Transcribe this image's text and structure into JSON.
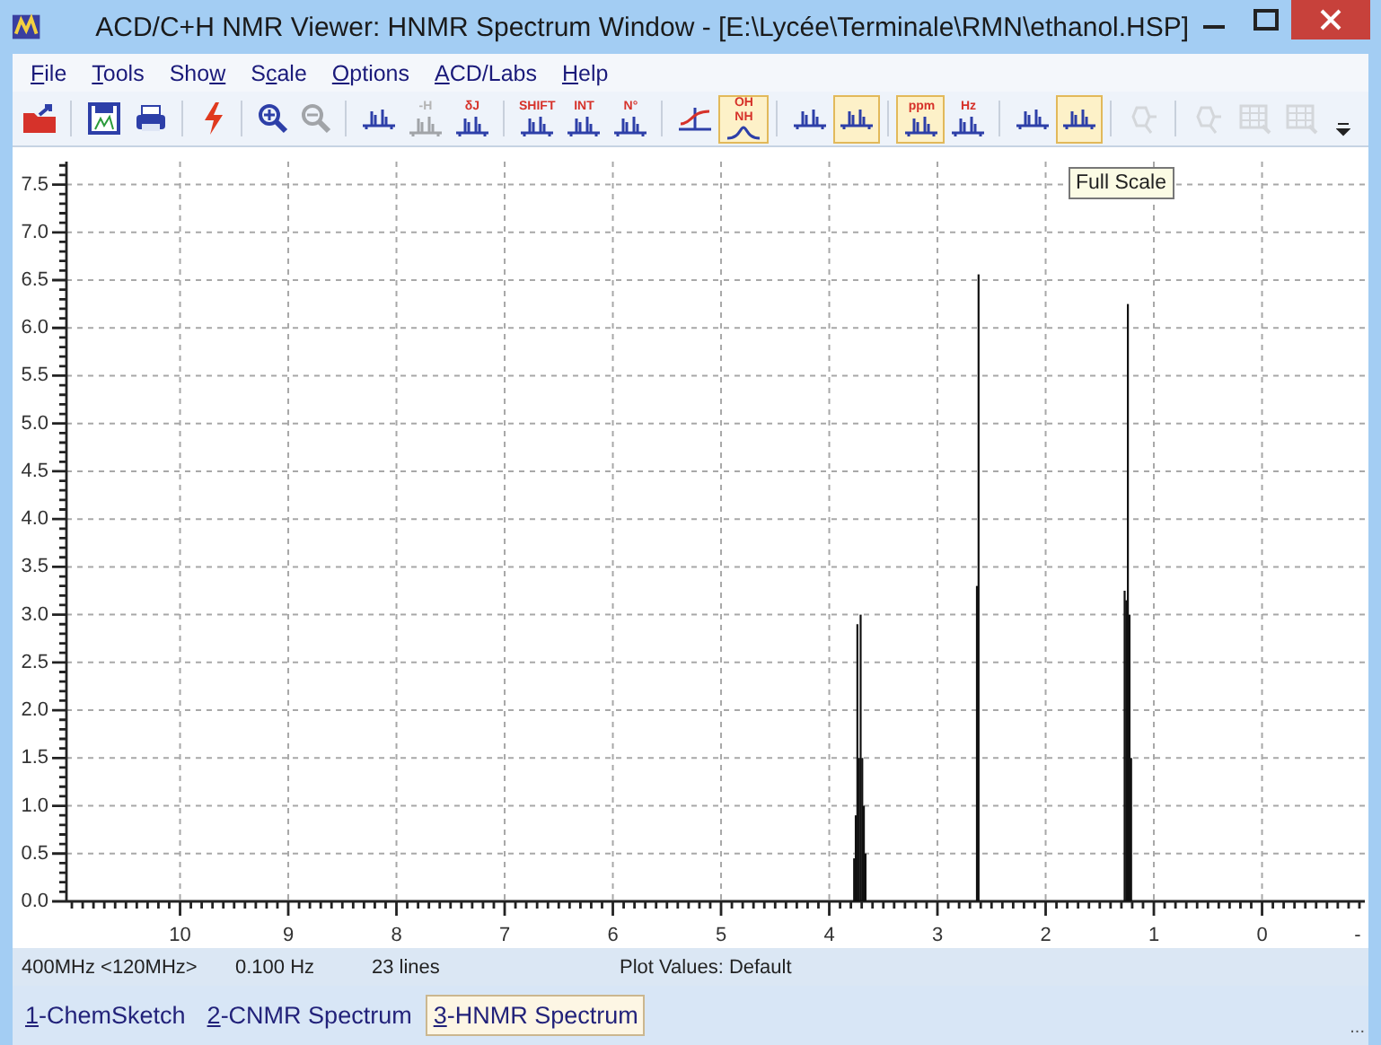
{
  "window": {
    "title": "ACD/C+H NMR Viewer: HNMR Spectrum Window - [E:\\Lycée\\Terminale\\RMN\\ethanol.HSP]"
  },
  "menu": [
    {
      "key": "F",
      "post": "ile"
    },
    {
      "key": "T",
      "post": "ools"
    },
    {
      "pre": "Sho",
      "key": "w"
    },
    {
      "pre": "S",
      "key": "c",
      "post": "ale"
    },
    {
      "key": "O",
      "post": "ptions"
    },
    {
      "key": "A",
      "post": "CD/Labs"
    },
    {
      "key": "H",
      "post": "elp"
    }
  ],
  "toolbar": [
    {
      "kind": "open",
      "separator_before": false,
      "selected": false,
      "disabled": false
    },
    {
      "kind": "save",
      "separator_before": true,
      "selected": false,
      "disabled": false
    },
    {
      "kind": "print",
      "separator_before": false,
      "selected": false,
      "disabled": false
    },
    {
      "kind": "lightning",
      "separator_before": true,
      "selected": false,
      "disabled": false
    },
    {
      "kind": "zoom-in",
      "separator_before": true,
      "selected": false,
      "disabled": false
    },
    {
      "kind": "zoom-out",
      "separator_before": false,
      "selected": false,
      "disabled": true
    },
    {
      "kind": "peaks",
      "separator_before": true,
      "selected": false,
      "disabled": false
    },
    {
      "kind": "peaks",
      "label": "-H",
      "separator_before": false,
      "selected": false,
      "disabled": true
    },
    {
      "kind": "peaks",
      "label": "δJ",
      "separator_before": false,
      "selected": false,
      "disabled": false
    },
    {
      "kind": "peaks",
      "label": "SHIFT",
      "separator_before": true,
      "selected": false,
      "disabled": false
    },
    {
      "kind": "peaks",
      "label": "INT",
      "separator_before": false,
      "selected": false,
      "disabled": false
    },
    {
      "kind": "peaks",
      "label": "N°",
      "separator_before": false,
      "selected": false,
      "disabled": false
    },
    {
      "kind": "slope",
      "separator_before": true,
      "selected": false,
      "disabled": false
    },
    {
      "kind": "curve",
      "label": "OH NH",
      "separator_before": false,
      "selected": true,
      "disabled": false
    },
    {
      "kind": "peaks",
      "separator_before": true,
      "selected": false,
      "disabled": false
    },
    {
      "kind": "peaks",
      "separator_before": false,
      "selected": true,
      "disabled": false
    },
    {
      "kind": "peaks",
      "label": "ppm",
      "separator_before": true,
      "selected": true,
      "disabled": false
    },
    {
      "kind": "peaks",
      "label": "Hz",
      "separator_before": false,
      "selected": false,
      "disabled": false
    },
    {
      "kind": "peaks",
      "separator_before": true,
      "selected": false,
      "disabled": false
    },
    {
      "kind": "peaks",
      "separator_before": false,
      "selected": true,
      "disabled": false
    },
    {
      "kind": "molecule",
      "separator_before": true,
      "selected": false,
      "disabled": true
    },
    {
      "kind": "molecule",
      "separator_before": true,
      "selected": false,
      "disabled": true
    },
    {
      "kind": "table",
      "separator_before": false,
      "selected": false,
      "disabled": true
    },
    {
      "kind": "table",
      "separator_before": false,
      "selected": false,
      "disabled": true
    }
  ],
  "toolbar_overflow_button": true,
  "spectrum": {
    "tooltip": "Full Scale",
    "chart_data": {
      "type": "bar",
      "x": [
        3.77,
        3.755,
        3.74,
        3.725,
        3.71,
        3.695,
        3.68,
        3.665,
        2.635,
        2.62,
        1.27,
        1.255,
        1.24,
        1.225,
        1.21
      ],
      "values": [
        0.45,
        0.9,
        2.9,
        1.5,
        3.0,
        1.5,
        1.0,
        0.5,
        3.3,
        6.56,
        3.25,
        3.15,
        6.25,
        3.0,
        1.5
      ],
      "xlim": [
        11.05,
        -0.95
      ],
      "ylim": [
        0,
        7.74
      ],
      "grid": true,
      "xticks": [
        10,
        9,
        8,
        7,
        6,
        5,
        4,
        3,
        2,
        1,
        0
      ],
      "yticks": [
        {
          "value": 0,
          "label": "0.0"
        },
        {
          "value": 0.5,
          "label": "0.5"
        },
        {
          "value": 1,
          "label": "1.0"
        },
        {
          "value": 1.5,
          "label": "1.5"
        },
        {
          "value": 2,
          "label": "2.0"
        },
        {
          "value": 2.5,
          "label": "2.5"
        },
        {
          "value": 3,
          "label": "3.0"
        },
        {
          "value": 3.5,
          "label": "3.5"
        },
        {
          "value": 4,
          "label": "4.0"
        },
        {
          "value": 4.5,
          "label": "4.5"
        },
        {
          "value": 5,
          "label": "5.0"
        },
        {
          "value": 5.5,
          "label": "5.5"
        },
        {
          "value": 6,
          "label": "6.0"
        },
        {
          "value": 6.5,
          "label": "6.5"
        },
        {
          "value": 7,
          "label": "7.0"
        },
        {
          "value": 7.5,
          "label": "7.5"
        }
      ]
    },
    "x_axis_cut_label": "-"
  },
  "status_bar": [
    "400MHz <120MHz>",
    "0.100 Hz",
    "23 lines",
    "Plot Values: Default"
  ],
  "tabs": [
    {
      "key": "1",
      "post": "-ChemSketch",
      "selected": false
    },
    {
      "key": "2",
      "post": "-CNMR Spectrum",
      "selected": false
    },
    {
      "key": "3",
      "post": "-HNMR Spectrum",
      "selected": true
    }
  ],
  "tabs_overflow": "..."
}
